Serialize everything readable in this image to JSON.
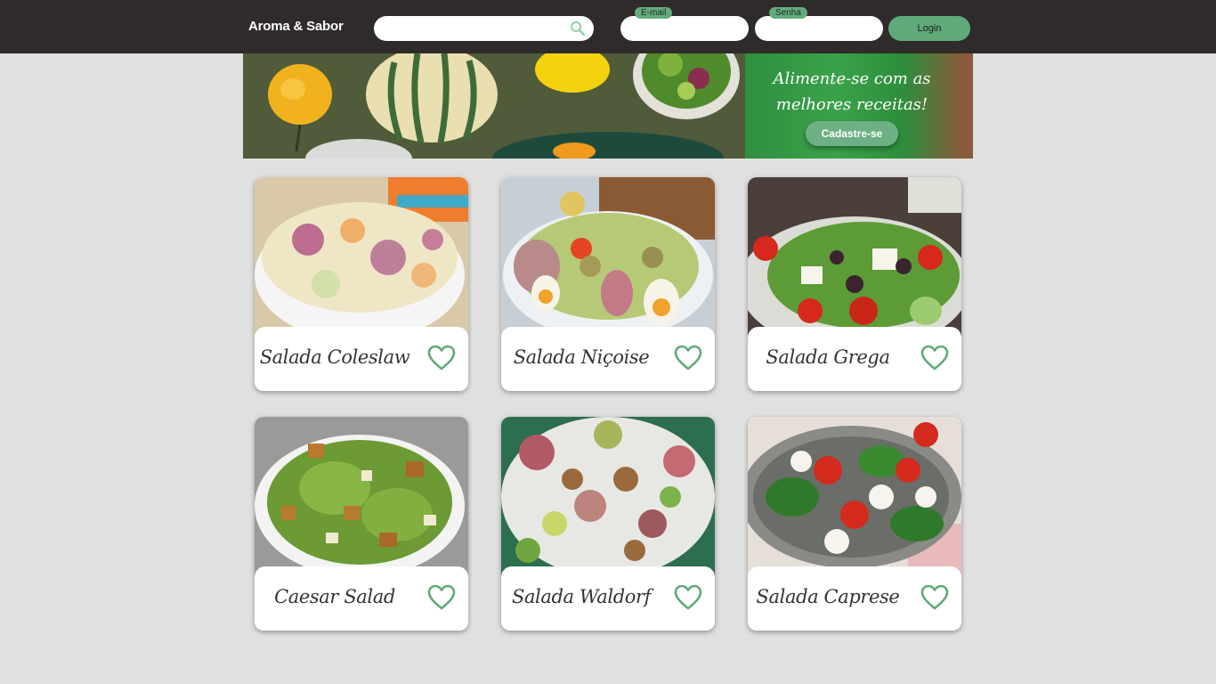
{
  "header": {
    "brand": "Aroma & Sabor",
    "search": {
      "placeholder": "",
      "value": "",
      "icon": "search-icon"
    },
    "email": {
      "tag": "E-mail",
      "value": ""
    },
    "senha": {
      "tag": "Senha",
      "value": ""
    },
    "login_label": "Login"
  },
  "banner": {
    "promo_line1": "Alimente-se com as",
    "promo_line2": "melhores receitas!",
    "signup_label": "Cadastre-se"
  },
  "colors": {
    "header_bg": "#2f2b2a",
    "accent_green": "#5faa7a",
    "page_bg": "#e0e0e0",
    "heart_green": "#5faa7a"
  },
  "recipes": [
    {
      "title": "Salada Coleslaw",
      "icon": "heart-icon"
    },
    {
      "title": "Salada Niçoise",
      "icon": "heart-icon"
    },
    {
      "title": "Salada Grega",
      "icon": "heart-icon"
    },
    {
      "title": "Caesar Salad",
      "icon": "heart-icon"
    },
    {
      "title": "Salada Waldorf",
      "icon": "heart-icon"
    },
    {
      "title": "Salada Caprese",
      "icon": "heart-icon"
    }
  ]
}
